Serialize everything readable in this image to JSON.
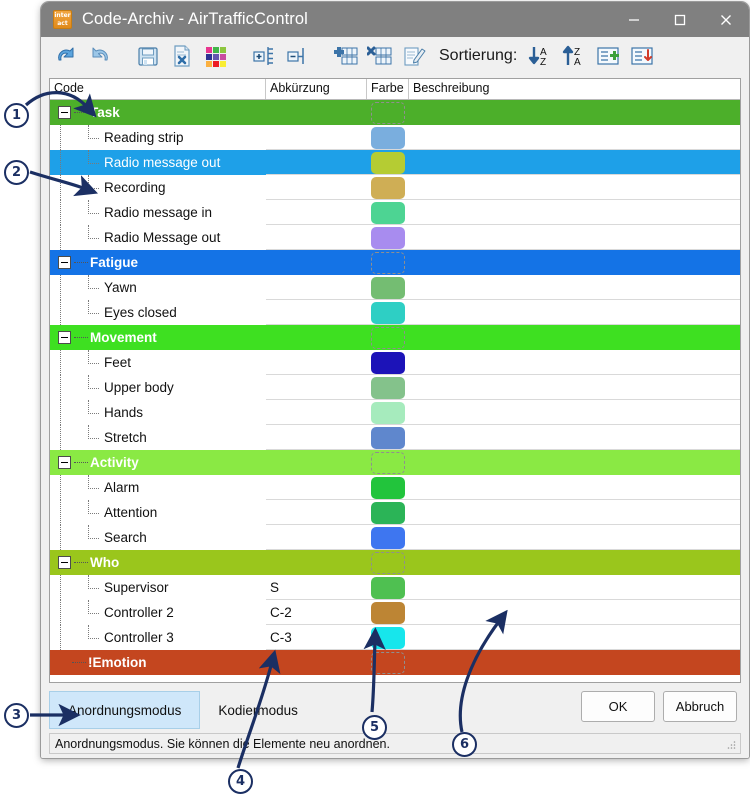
{
  "window": {
    "title": "Code-Archiv - AirTrafficControl",
    "app_icon": "inter-act-logo-icon",
    "minimize": "minimize-icon",
    "maximize": "maximize-icon",
    "close": "close-icon"
  },
  "toolbar": {
    "items": [
      {
        "name": "undo-icon",
        "title": "Undo"
      },
      {
        "name": "redo-icon",
        "title": "Redo"
      },
      {
        "name": "save-icon",
        "title": "Save"
      },
      {
        "name": "delete-document-icon",
        "title": "Delete"
      },
      {
        "name": "color-palette-icon",
        "title": "Colors"
      },
      {
        "name": "expand-all-icon",
        "title": "Expand"
      },
      {
        "name": "collapse-all-icon",
        "title": "Collapse"
      },
      {
        "name": "add-row-icon",
        "title": "Add row"
      },
      {
        "name": "delete-row-icon",
        "title": "Delete row"
      },
      {
        "name": "edit-notes-icon",
        "title": "Edit"
      }
    ],
    "sort_label": "Sortierung:",
    "sort_items": [
      {
        "name": "sort-ascending-az-icon",
        "title": "A-Z"
      },
      {
        "name": "sort-descending-za-icon",
        "title": "Z-A"
      },
      {
        "name": "add-sort-icon",
        "title": "Add"
      },
      {
        "name": "remove-sort-icon",
        "title": "Remove"
      }
    ]
  },
  "tree": {
    "columns": [
      "Code",
      "Abkürzung",
      "Farbe",
      "Beschreibung"
    ],
    "rows": [
      {
        "type": "group",
        "label": "Task",
        "abbr": "",
        "color": "#4caf2a",
        "row_bg": "#4caf2a",
        "swatch_dashed": true
      },
      {
        "type": "child",
        "label": "Reading strip",
        "abbr": "",
        "color": "#7aaede"
      },
      {
        "type": "child",
        "label": "Radio message out",
        "abbr": "",
        "color": "#b5cc33",
        "selected": true
      },
      {
        "type": "child",
        "label": "Recording",
        "abbr": "",
        "color": "#cfae55"
      },
      {
        "type": "child",
        "label": "Radio message in",
        "abbr": "",
        "color": "#4dd493"
      },
      {
        "type": "child",
        "label": "Radio Message out",
        "abbr": "",
        "color": "#a88cef"
      },
      {
        "type": "group",
        "label": "Fatigue",
        "abbr": "",
        "color": "#1473e6",
        "row_bg": "#1473e6",
        "swatch_dashed": true
      },
      {
        "type": "child",
        "label": "Yawn",
        "abbr": "",
        "color": "#74bd72"
      },
      {
        "type": "child",
        "label": "Eyes closed",
        "abbr": "",
        "color": "#2ecfc4"
      },
      {
        "type": "group",
        "label": "Movement",
        "abbr": "",
        "color": "#3ee021",
        "row_bg": "#3ee021",
        "swatch_dashed": true
      },
      {
        "type": "child",
        "label": "Feet",
        "abbr": "",
        "color": "#1c13b8"
      },
      {
        "type": "child",
        "label": "Upper body",
        "abbr": "",
        "color": "#84c28b"
      },
      {
        "type": "child",
        "label": "Hands",
        "abbr": "",
        "color": "#a6ebbd"
      },
      {
        "type": "child",
        "label": "Stretch",
        "abbr": "",
        "color": "#5f87cd"
      },
      {
        "type": "group",
        "label": "Activity",
        "abbr": "",
        "color": "#8ae944",
        "row_bg": "#8ae944",
        "swatch_dashed": true
      },
      {
        "type": "child",
        "label": "Alarm",
        "abbr": "",
        "color": "#22c43c"
      },
      {
        "type": "child",
        "label": "Attention",
        "abbr": "",
        "color": "#2bb457"
      },
      {
        "type": "child",
        "label": "Search",
        "abbr": "",
        "color": "#3e76f0"
      },
      {
        "type": "group",
        "label": "Who",
        "abbr": "",
        "color": "#9ac61c",
        "row_bg": "#9ac61c",
        "swatch_dashed": true
      },
      {
        "type": "child",
        "label": "Supervisor",
        "abbr": "S",
        "color": "#4fc051"
      },
      {
        "type": "child",
        "label": "Controller 2",
        "abbr": "C-2",
        "color": "#bd8534"
      },
      {
        "type": "child",
        "label": "Controller 3",
        "abbr": "C-3",
        "color": "#17e6ec"
      },
      {
        "type": "group",
        "label": "!Emotion",
        "abbr": "",
        "color": "#c4461f",
        "row_bg": "#c4461f",
        "swatch_dashed": true,
        "no_expander": true
      }
    ]
  },
  "bottom": {
    "tab_active": "Anordnungsmodus",
    "tab_inactive": "Kodiermodus",
    "ok": "OK",
    "cancel": "Abbruch",
    "status": "Anordnungsmodus. Sie können die Elemente neu anordnen."
  },
  "annotations": [
    {
      "id": "1",
      "label": "1"
    },
    {
      "id": "2",
      "label": "2"
    },
    {
      "id": "3",
      "label": "3"
    },
    {
      "id": "4",
      "label": "4"
    },
    {
      "id": "5",
      "label": "5"
    },
    {
      "id": "6",
      "label": "6"
    }
  ],
  "colors": {
    "titlebar": "#808080",
    "selection": "#1ea0e8",
    "annotation": "#1b2f63",
    "tab_active_bg": "#cfe7fa"
  }
}
